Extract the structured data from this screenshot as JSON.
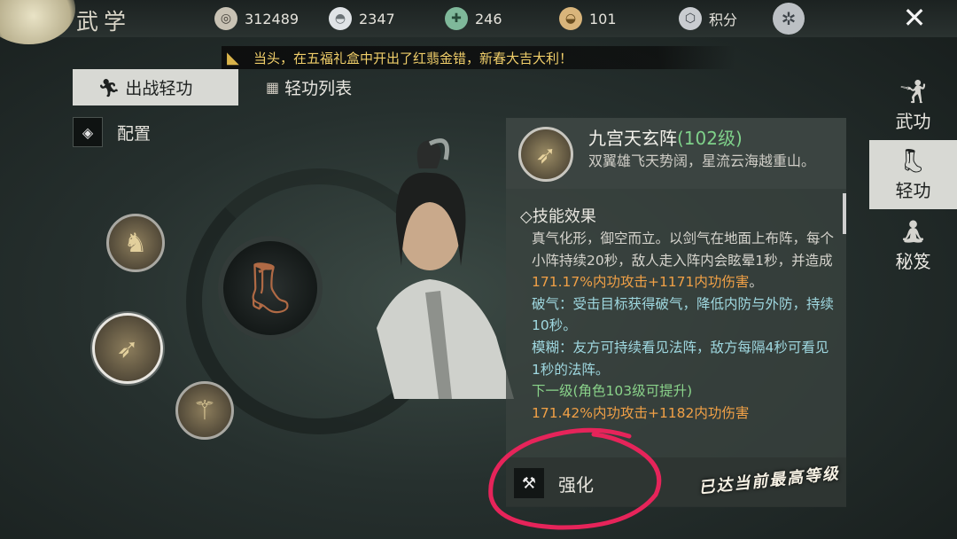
{
  "header": {
    "title": "武学",
    "resources": [
      {
        "icon": "coin-icon",
        "value": "312489"
      },
      {
        "icon": "silver-ingot-icon",
        "value": "2347"
      },
      {
        "icon": "jade-ticket-icon",
        "value": "246"
      },
      {
        "icon": "gold-ingot-icon",
        "value": "101"
      },
      {
        "icon": "points-shield-icon",
        "value": "积分"
      }
    ]
  },
  "marquee": {
    "text": "当头，在五福礼盒中开出了红翡金错，新春大吉大利！"
  },
  "tabs": [
    {
      "label": "出战轻功"
    },
    {
      "label": "轻功列表"
    }
  ],
  "config": {
    "label": "配置"
  },
  "skill": {
    "name": "九宫天玄阵",
    "level": "(102级)",
    "motto": "双翼雄飞天势阔，星流云海越重山。",
    "effect_title": "◇技能效果",
    "lines": {
      "l1": "真气化形，御空而立。以剑气在地面上布阵，每个小阵持续20秒，敌人走入阵内会眩晕1秒，并造成",
      "l1_orange": "171.17%内功攻击+1171内功伤害",
      "l1_end": "。",
      "l2": "破气：受击目标获得破气，降低内防与外防，持续10秒。",
      "l3": "模糊：友方可持续看见法阵，敌方每隔4秒可看见1秒的法阵。",
      "l4": "下一级(角色103级可提升)",
      "l5": "171.42%内功攻击+1182内功伤害"
    }
  },
  "upgrade": {
    "label": "强化",
    "max_level_text": "已达当前最高等级"
  },
  "nav": [
    {
      "label": "武功"
    },
    {
      "label": "轻功"
    },
    {
      "label": "秘笈"
    }
  ]
}
